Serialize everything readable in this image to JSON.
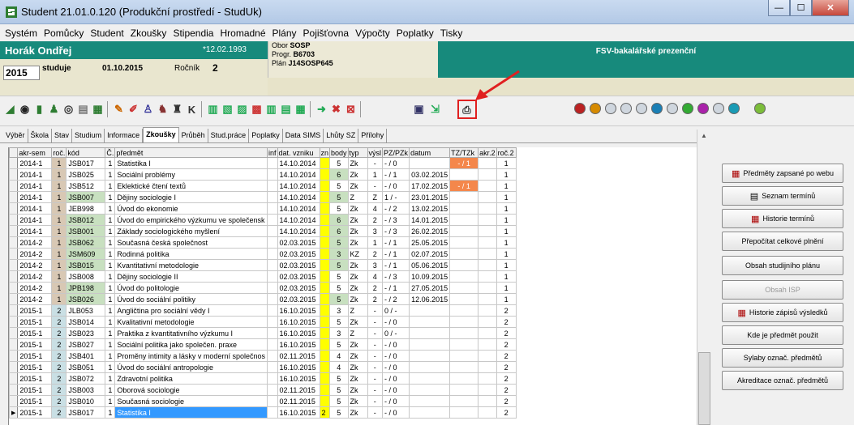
{
  "window": {
    "title": "Student  21.01.0.120  (Produkční prostředí - StudUk)"
  },
  "menu": [
    "Systém",
    "Pomůcky",
    "Student",
    "Zkoušky",
    "Stipendia",
    "Hromadné",
    "Plány",
    "Pojišťovna",
    "Výpočty",
    "Poplatky",
    "Tisky"
  ],
  "student": {
    "name": "Horák Ondřej",
    "birth": "*12.02.1993",
    "year": "2015",
    "status": "studuje",
    "start_date": "01.10.2015",
    "rocnik_label": "Ročník",
    "rocnik": "2",
    "obor_label": "Obor",
    "obor": "SOSP",
    "progr_label": "Progr.",
    "progr": "B6703",
    "plan_label": "Plán",
    "plan": "J14SOSP645",
    "faculty": "FSV-bakalářské prezenční"
  },
  "tabs": [
    "Výběr",
    "Škola",
    "Stav",
    "Studium",
    "Informace",
    "Zkoušky",
    "Průběh",
    "Stud.práce",
    "Poplatky",
    "Data SIMS",
    "Lhůty SZ",
    "Přílohy"
  ],
  "active_tab": "Zkoušky",
  "table": {
    "headers": [
      "akr-sem",
      "roč.",
      "kód",
      "Č.",
      "předmět",
      "inf",
      "dat. vzniku",
      "zn",
      "body",
      "typ",
      "výsl",
      "PZ/PZk",
      "datum",
      "TZ/TZk",
      "akr.2",
      "roč.2"
    ],
    "rows": [
      [
        "2014-1",
        "1",
        "JSB017",
        "1",
        "Statistika I",
        "",
        "14.10.2014",
        "",
        "5",
        "Zk",
        "-",
        "- / 0",
        "",
        "- / 1",
        "",
        "1"
      ],
      [
        "2014-1",
        "1",
        "JSB025",
        "1",
        "Sociální problémy",
        "",
        "14.10.2014",
        "",
        "6",
        "Zk",
        "1",
        "- / 1",
        "03.02.2015",
        "",
        "",
        "1"
      ],
      [
        "2014-1",
        "1",
        "JSB512",
        "1",
        "Eklektické čtení textů",
        "",
        "14.10.2014",
        "",
        "5",
        "Zk",
        "-",
        "- / 0",
        "17.02.2015",
        "- / 1",
        "",
        "1"
      ],
      [
        "2014-1",
        "1",
        "JSB007",
        "1",
        "Dějiny sociologie I",
        "",
        "14.10.2014",
        "",
        "5",
        "Z",
        "Z",
        "1 / -",
        "23.01.2015",
        "",
        "",
        "1"
      ],
      [
        "2014-1",
        "1",
        "JEB998",
        "1",
        "Úvod do ekonomie",
        "",
        "14.10.2014",
        "",
        "5",
        "Zk",
        "4",
        "- / 2",
        "13.02.2015",
        "",
        "",
        "1"
      ],
      [
        "2014-1",
        "1",
        "JSB012",
        "1",
        "Úvod do empirického výzkumu ve společensk",
        "",
        "14.10.2014",
        "",
        "6",
        "Zk",
        "2",
        "- / 3",
        "14.01.2015",
        "",
        "",
        "1"
      ],
      [
        "2014-1",
        "1",
        "JSB001",
        "1",
        "Základy sociologického myšlení",
        "",
        "14.10.2014",
        "",
        "6",
        "Zk",
        "3",
        "- / 3",
        "26.02.2015",
        "",
        "",
        "1"
      ],
      [
        "2014-2",
        "1",
        "JSB062",
        "1",
        "Současná česká společnost",
        "",
        "02.03.2015",
        "",
        "5",
        "Zk",
        "1",
        "- / 1",
        "25.05.2015",
        "",
        "",
        "1"
      ],
      [
        "2014-2",
        "1",
        "JSM609",
        "1",
        "Rodinná politika",
        "",
        "02.03.2015",
        "",
        "3",
        "KZ",
        "2",
        "- / 1",
        "02.07.2015",
        "",
        "",
        "1"
      ],
      [
        "2014-2",
        "1",
        "JSB015",
        "1",
        "Kvantitativní metodologie",
        "",
        "02.03.2015",
        "",
        "5",
        "Zk",
        "3",
        "- / 1",
        "05.06.2015",
        "",
        "",
        "1"
      ],
      [
        "2014-2",
        "1",
        "JSB008",
        "1",
        "Dějiny sociologie II",
        "",
        "02.03.2015",
        "",
        "5",
        "Zk",
        "4",
        "- / 3",
        "10.09.2015",
        "",
        "",
        "1"
      ],
      [
        "2014-2",
        "1",
        "JPB198",
        "1",
        "Úvod do politologie",
        "",
        "02.03.2015",
        "",
        "5",
        "Zk",
        "2",
        "- / 1",
        "27.05.2015",
        "",
        "",
        "1"
      ],
      [
        "2014-2",
        "1",
        "JSB026",
        "1",
        "Úvod do sociální politiky",
        "",
        "02.03.2015",
        "",
        "5",
        "Zk",
        "2",
        "- / 2",
        "12.06.2015",
        "",
        "",
        "1"
      ],
      [
        "2015-1",
        "2",
        "JLB053",
        "1",
        "Angličtina pro sociální vědy I",
        "",
        "16.10.2015",
        "",
        "3",
        "Z",
        "-",
        "0 / -",
        "",
        "",
        "",
        "2"
      ],
      [
        "2015-1",
        "2",
        "JSB014",
        "1",
        "Kvalitativní metodologie",
        "",
        "16.10.2015",
        "",
        "5",
        "Zk",
        "-",
        "- / 0",
        "",
        "",
        "",
        "2"
      ],
      [
        "2015-1",
        "2",
        "JSB023",
        "1",
        "Praktika  z kvantitativního výzkumu I",
        "",
        "16.10.2015",
        "",
        "3",
        "Z",
        "-",
        "0 / -",
        "",
        "",
        "",
        "2"
      ],
      [
        "2015-1",
        "2",
        "JSB027",
        "1",
        "Sociální politika jako společen. praxe",
        "",
        "16.10.2015",
        "",
        "5",
        "Zk",
        "-",
        "- / 0",
        "",
        "",
        "",
        "2"
      ],
      [
        "2015-1",
        "2",
        "JSB401",
        "1",
        "Proměny intimity a lásky v moderní společnos",
        "",
        "02.11.2015",
        "",
        "4",
        "Zk",
        "-",
        "- / 0",
        "",
        "",
        "",
        "2"
      ],
      [
        "2015-1",
        "2",
        "JSB051",
        "1",
        "Úvod do sociální antropologie",
        "",
        "16.10.2015",
        "",
        "4",
        "Zk",
        "-",
        "- / 0",
        "",
        "",
        "",
        "2"
      ],
      [
        "2015-1",
        "2",
        "JSB072",
        "1",
        "Zdravotní politika",
        "",
        "16.10.2015",
        "",
        "5",
        "Zk",
        "-",
        "- / 0",
        "",
        "",
        "",
        "2"
      ],
      [
        "2015-1",
        "2",
        "JSB003",
        "1",
        "Oborová sociologie",
        "",
        "02.11.2015",
        "",
        "5",
        "Zk",
        "-",
        "- / 0",
        "",
        "",
        "",
        "2"
      ],
      [
        "2015-1",
        "2",
        "JSB010",
        "1",
        "Současná sociologie",
        "",
        "02.11.2015",
        "",
        "5",
        "Zk",
        "-",
        "- / 0",
        "",
        "",
        "",
        "2"
      ],
      [
        "2015-1",
        "2",
        "JSB017",
        "1",
        "Statistika I",
        "",
        "16.10.2015",
        "2",
        "5",
        "Zk",
        "-",
        "- / 0",
        "",
        "",
        "",
        "2"
      ]
    ]
  },
  "right_buttons": [
    {
      "label": "Předměty zapsané po webu",
      "icon": "calendar-icon"
    },
    {
      "label": "Seznam termínů",
      "icon": "list-icon"
    },
    {
      "label": "Historie termínů",
      "icon": "calendar-icon"
    },
    {
      "label": "Přepočítat celkové plnění",
      "icon": ""
    },
    {
      "label": "Obsah studijního plánu",
      "icon": ""
    },
    {
      "label": "Obsah ISP",
      "icon": ""
    },
    {
      "label": "Historie zápisů výsledků",
      "icon": "calendar-icon"
    },
    {
      "label": "Kde je předmět použit",
      "icon": ""
    },
    {
      "label": "Sylaby označ. předmětů",
      "icon": ""
    },
    {
      "label": "Akreditace označ. předmětů",
      "icon": ""
    }
  ],
  "colors": {
    "teal": "#178a7c",
    "tan": "#e7e3c9",
    "zn_yellow": "#ffff00",
    "tz_orange": "#f4874b",
    "body_green": "#c8e0c0",
    "selected": "#3399ff",
    "arrow_red": "#e02020"
  }
}
